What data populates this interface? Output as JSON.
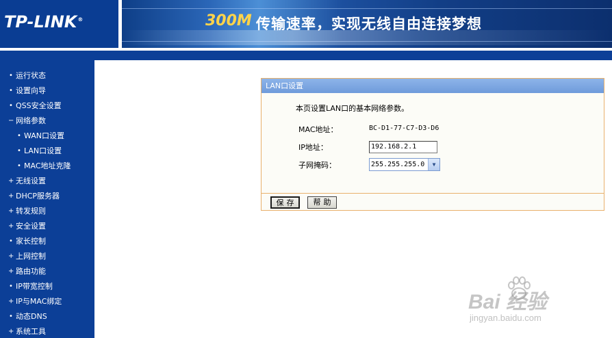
{
  "header": {
    "logo": "TP-LINK",
    "logo_mark": "®",
    "banner_speed": "300M",
    "banner_slogan": "传输速率，实现无线自由连接梦想"
  },
  "sidebar": {
    "items": [
      {
        "bullet": "•",
        "label": "运行状态"
      },
      {
        "bullet": "•",
        "label": "设置向导"
      },
      {
        "bullet": "•",
        "label": "QSS安全设置"
      },
      {
        "bullet": "−",
        "label": "网络参数"
      },
      {
        "bullet": "•",
        "label": "WAN口设置"
      },
      {
        "bullet": "•",
        "label": "LAN口设置"
      },
      {
        "bullet": "•",
        "label": "MAC地址克隆"
      },
      {
        "bullet": "+",
        "label": "无线设置"
      },
      {
        "bullet": "+",
        "label": "DHCP服务器"
      },
      {
        "bullet": "+",
        "label": "转发规则"
      },
      {
        "bullet": "+",
        "label": "安全设置"
      },
      {
        "bullet": "•",
        "label": "家长控制"
      },
      {
        "bullet": "+",
        "label": "上网控制"
      },
      {
        "bullet": "+",
        "label": "路由功能"
      },
      {
        "bullet": "•",
        "label": "IP带宽控制"
      },
      {
        "bullet": "+",
        "label": "IP与MAC绑定"
      },
      {
        "bullet": "•",
        "label": "动态DNS"
      },
      {
        "bullet": "+",
        "label": "系统工具"
      }
    ]
  },
  "panel": {
    "title": "LAN口设置",
    "description": "本页设置LAN口的基本网络参数。",
    "mac_label": "MAC地址：",
    "mac_value": "BC-D1-77-C7-D3-D6",
    "ip_label": "IP地址：",
    "ip_value": "192.168.2.1",
    "mask_label": "子网掩码：",
    "mask_value": "255.255.255.0",
    "save_label": "保存",
    "help_label": "帮助"
  },
  "watermark": {
    "brand": "Bai  经验",
    "url": "jingyan.baidu.com"
  },
  "colors": {
    "nav_blue": "#0c3f97",
    "panel_border": "#e8b06b",
    "panel_title": "#7ca5e1"
  }
}
